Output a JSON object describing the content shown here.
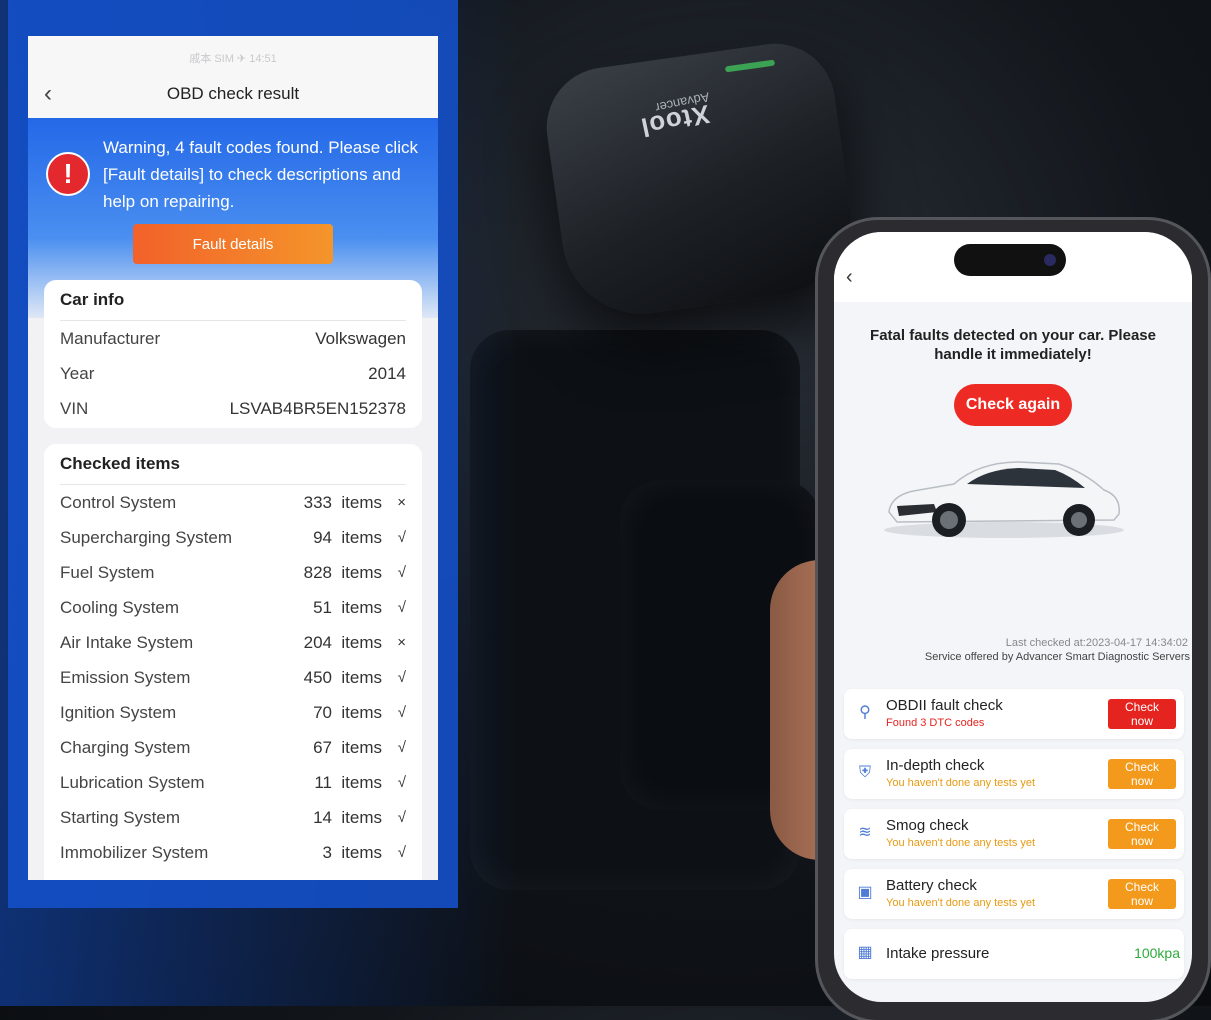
{
  "colors": {
    "accent_blue": "#1450c8",
    "warning_red": "#e3282e",
    "button_orange": "#f4952a",
    "check_now_red": "#e52420",
    "ok_green": "#2eaa3a"
  },
  "device": {
    "brand": "Xtool",
    "model": "Advancer"
  },
  "left_app": {
    "status_bar_text": "戚本 SIM ✈ 14:51",
    "title": "OBD check result",
    "back_icon": "chevron-left-icon",
    "warning": {
      "icon": "exclamation-circle-icon",
      "text": "Warning, 4 fault codes found. Please click [Fault details] to check descriptions and help on repairing.",
      "button": "Fault details"
    },
    "car_info": {
      "title": "Car info",
      "rows": [
        {
          "label": "Manufacturer",
          "value": "Volkswagen"
        },
        {
          "label": "Year",
          "value": "2014"
        },
        {
          "label": "VIN",
          "value": "LSVAB4BR5EN152378"
        }
      ]
    },
    "checked_items": {
      "title": "Checked items",
      "rows": [
        {
          "name": "Control System",
          "count": "333",
          "unit": "items",
          "mark": "×"
        },
        {
          "name": "Supercharging System",
          "count": "94",
          "unit": "items",
          "mark": "√"
        },
        {
          "name": "Fuel System",
          "count": "828",
          "unit": "items",
          "mark": "√"
        },
        {
          "name": "Cooling System",
          "count": "51",
          "unit": "items",
          "mark": "√"
        },
        {
          "name": "Air Intake System",
          "count": "204",
          "unit": "items",
          "mark": "×"
        },
        {
          "name": "Emission System",
          "count": "450",
          "unit": "items",
          "mark": "√"
        },
        {
          "name": "Ignition System",
          "count": "70",
          "unit": "items",
          "mark": "√"
        },
        {
          "name": "Charging System",
          "count": "67",
          "unit": "items",
          "mark": "√"
        },
        {
          "name": "Lubrication System",
          "count": "11",
          "unit": "items",
          "mark": "√"
        },
        {
          "name": "Starting System",
          "count": "14",
          "unit": "items",
          "mark": "√"
        },
        {
          "name": "Immobilizer System",
          "count": "3",
          "unit": "items",
          "mark": "√"
        }
      ]
    }
  },
  "right_app": {
    "back_icon": "chevron-left-icon",
    "alert": "Fatal faults detected on your car. Please handle it immediately!",
    "check_again": "Check again",
    "last_checked": "Last checked at:2023-04-17 14:34:02",
    "service": "Service offered by Advancer Smart Diagnostic Servers",
    "checks": [
      {
        "icon": "search-icon",
        "title": "OBDII fault check",
        "subtitle": "Found 3 DTC codes",
        "button": "Check now"
      },
      {
        "icon": "shield-icon",
        "title": "In-depth check",
        "subtitle": "You haven't done any tests yet",
        "button": "Check now"
      },
      {
        "icon": "smog-icon",
        "title": "Smog check",
        "subtitle": "You haven't done any tests yet",
        "button": "Check now"
      },
      {
        "icon": "battery-icon",
        "title": "Battery check",
        "subtitle": "You haven't done any tests yet",
        "button": "Check now"
      },
      {
        "icon": "gauge-icon",
        "title": "Intake pressure",
        "value": "100kpa"
      }
    ]
  }
}
